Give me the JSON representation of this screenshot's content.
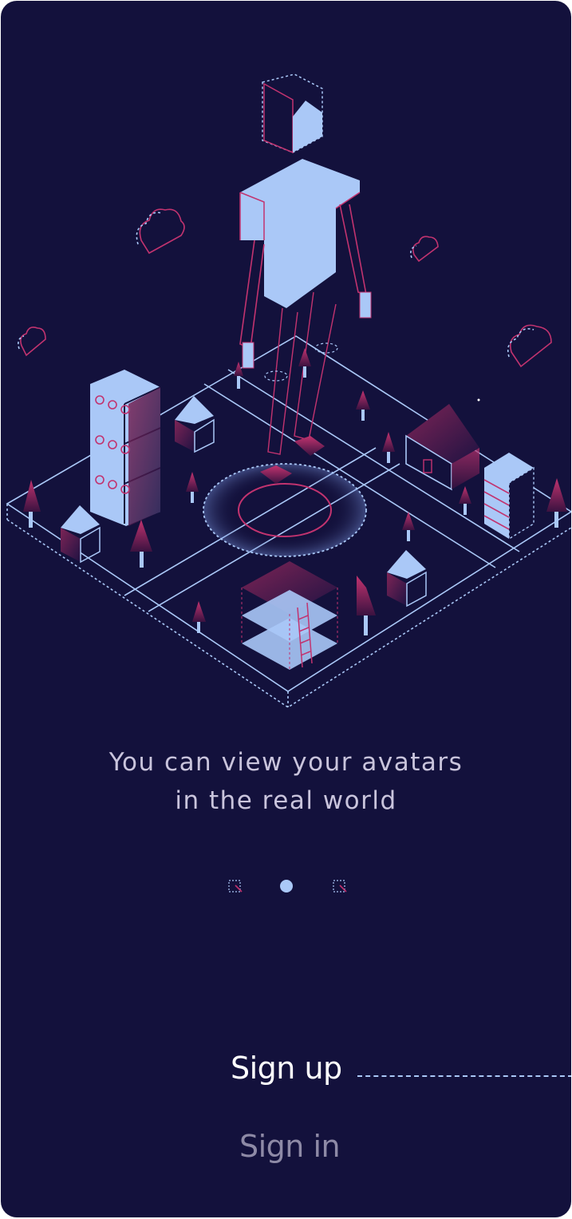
{
  "onboarding": {
    "caption_line1": "You can view your avatars",
    "caption_line2": "in the real world",
    "current_page": 2,
    "total_pages": 3
  },
  "actions": {
    "sign_up": "Sign up",
    "sign_in": "Sign in"
  },
  "colors": {
    "background": "#13113c",
    "accent_light": "#aac8f7",
    "accent_pink": "#c2336f",
    "text_primary": "#ffffff",
    "text_muted": "#8e8aa6"
  }
}
